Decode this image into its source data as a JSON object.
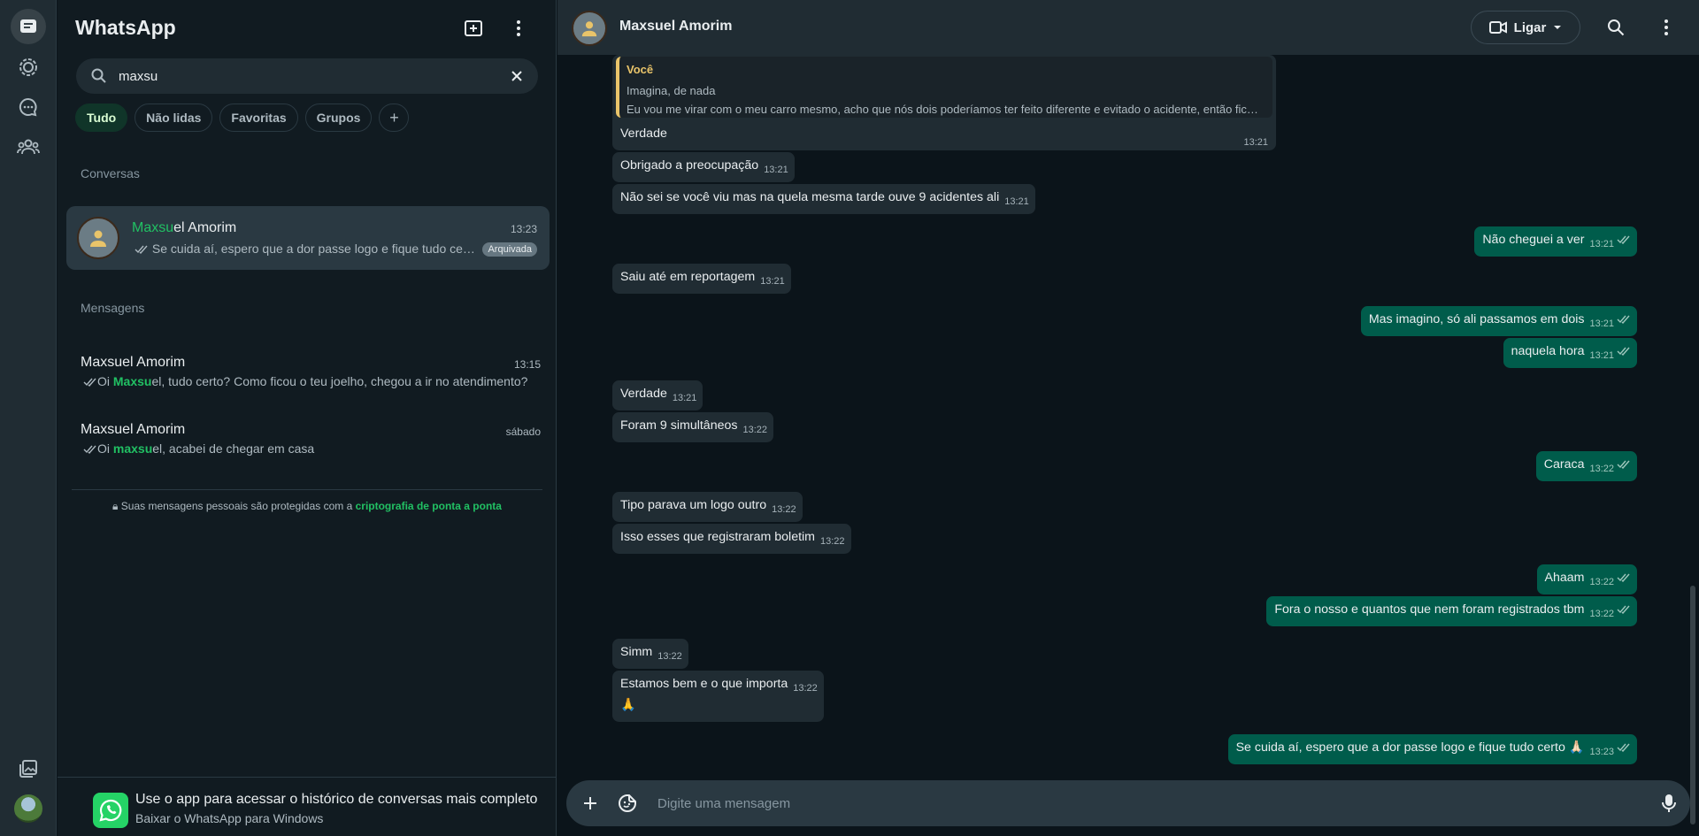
{
  "app": {
    "title": "WhatsApp"
  },
  "search": {
    "value": "maxsu",
    "placeholder": ""
  },
  "chips": [
    "Tudo",
    "Não lidas",
    "Favoritas",
    "Grupos"
  ],
  "sections": {
    "conversations": "Conversas",
    "messages": "Mensagens"
  },
  "conversation": {
    "name_highlight": "Maxsu",
    "name_rest": "el Amorim",
    "time": "13:23",
    "preview": "Se cuida aí, espero que a dor passe logo e fique tudo certo 🙏",
    "badge": "Arquivada"
  },
  "message_results": [
    {
      "name": "Maxsuel Amorim",
      "time": "13:15",
      "pre": "Oi ",
      "hl": "Maxsu",
      "post": "el, tudo certo? Como ficou o teu joelho, chegou a ir no atendimento?"
    },
    {
      "name": "Maxsuel Amorim",
      "time": "sábado",
      "pre": "Oi ",
      "hl": "maxsu",
      "post": "el, acabei de chegar em casa"
    }
  ],
  "encryption": {
    "text": "Suas mensagens pessoais são protegidas com a ",
    "link": "criptografia de ponta a ponta"
  },
  "promo": {
    "title": "Use o app para acessar o histórico de conversas mais completo",
    "subtitle": "Baixar o WhatsApp para Windows"
  },
  "chat": {
    "contact": "Maxsuel Amorim",
    "call_label": "Ligar",
    "quote": {
      "author": "Você",
      "line1": "Imagina, de nada",
      "line2": "Eu vou me virar com o meu carro mesmo, acho que nós dois poderíamos ter feito diferente e evitado o acidente, então fic…"
    },
    "messages": [
      {
        "text": "Verdade",
        "time": "13:21"
      },
      {
        "text": "Obrigado a preocupação",
        "time": "13:21"
      },
      {
        "text": "Não sei se você viu mas na quela mesma tarde ouve 9 acidentes ali",
        "time": "13:21"
      },
      {
        "text": "Não cheguei a ver",
        "time": "13:21"
      },
      {
        "text": "Saiu até em reportagem",
        "time": "13:21"
      },
      {
        "text": "Mas imagino, só ali passamos em dois",
        "time": "13:21"
      },
      {
        "text": "naquela hora",
        "time": "13:21"
      },
      {
        "text": "Verdade",
        "time": "13:21"
      },
      {
        "text": "Foram 9 simultâneos",
        "time": "13:22"
      },
      {
        "text": "Caraca",
        "time": "13:22"
      },
      {
        "text": "Tipo parava um logo outro",
        "time": "13:22"
      },
      {
        "text": "Isso esses que registraram boletim",
        "time": "13:22"
      },
      {
        "text": "Ahaam",
        "time": "13:22"
      },
      {
        "text": "Fora o nosso e quantos que nem foram registrados tbm",
        "time": "13:22"
      },
      {
        "text": "Simm",
        "time": "13:22"
      },
      {
        "text": "Estamos bem e o que importa",
        "time": "13:22"
      },
      {
        "text": "🙏",
        "time": ""
      },
      {
        "text": "Se cuida aí, espero que a dor passe logo e fique tudo certo 🙏🏻",
        "time": "13:23"
      }
    ]
  },
  "composer": {
    "placeholder": "Digite uma mensagem"
  }
}
